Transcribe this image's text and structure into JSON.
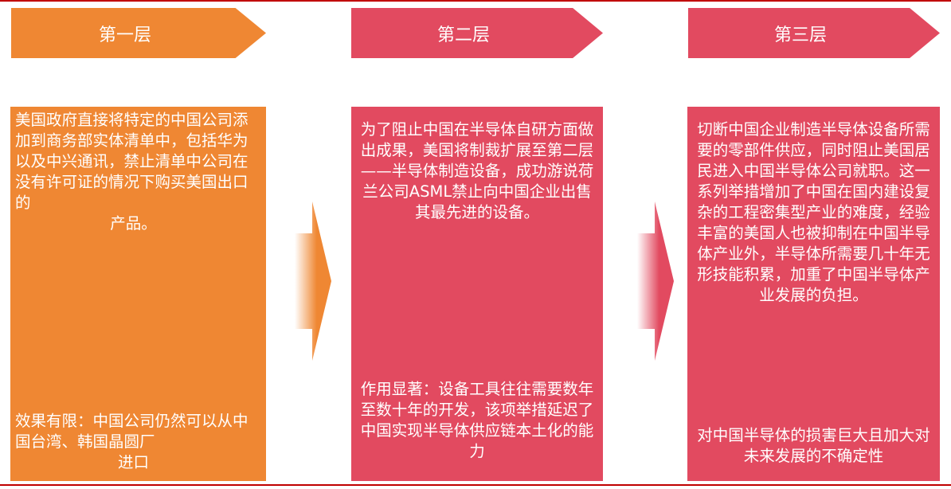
{
  "layers": [
    {
      "title": "第一层",
      "color": "#ef8733",
      "main_text": "美国政府直接将特定的中国公司添加到商务部实体清单中，包括华为以及中兴通讯，禁止清单中公司在没有许可证的情况下购买美国出口的",
      "main_text_last": "产品。",
      "effect_text": "效果有限：中国公司仍然可以从中国台湾、韩国晶圆厂",
      "effect_text_last": "进口"
    },
    {
      "title": "第二层",
      "color": "#e24a60",
      "main_text": "为了阻止中国在半导体自研方面做出成果，美国将制裁扩展至第二层——半导体制造设备，成功游说荷兰公司ASML禁止向中国企业出售其最先进的设备。",
      "effect_text": "作用显著：设备工具往往需要数年至数十年的开发，该项举措延迟了中国实现半导体供应链本土化的能力"
    },
    {
      "title": "第三层",
      "color": "#e24a60",
      "main_text": "切断中国企业制造半导体设备所需要的零部件供应，同时阻止美国居民进入中国半导体公司就职。这一系列举措增加了中国在国内建设复杂的工程密集型产业的难度，经验丰富的美国人也被抑制在中国半导体产业外，半导体所需要几十年无形技能积累，加重了中国半导体产业发展的负担。",
      "effect_text": "对中国半导体的损害巨大且加大对未来发展的不确定性"
    }
  ],
  "arrow_colors": [
    "#ef8733",
    "#e24a60"
  ]
}
